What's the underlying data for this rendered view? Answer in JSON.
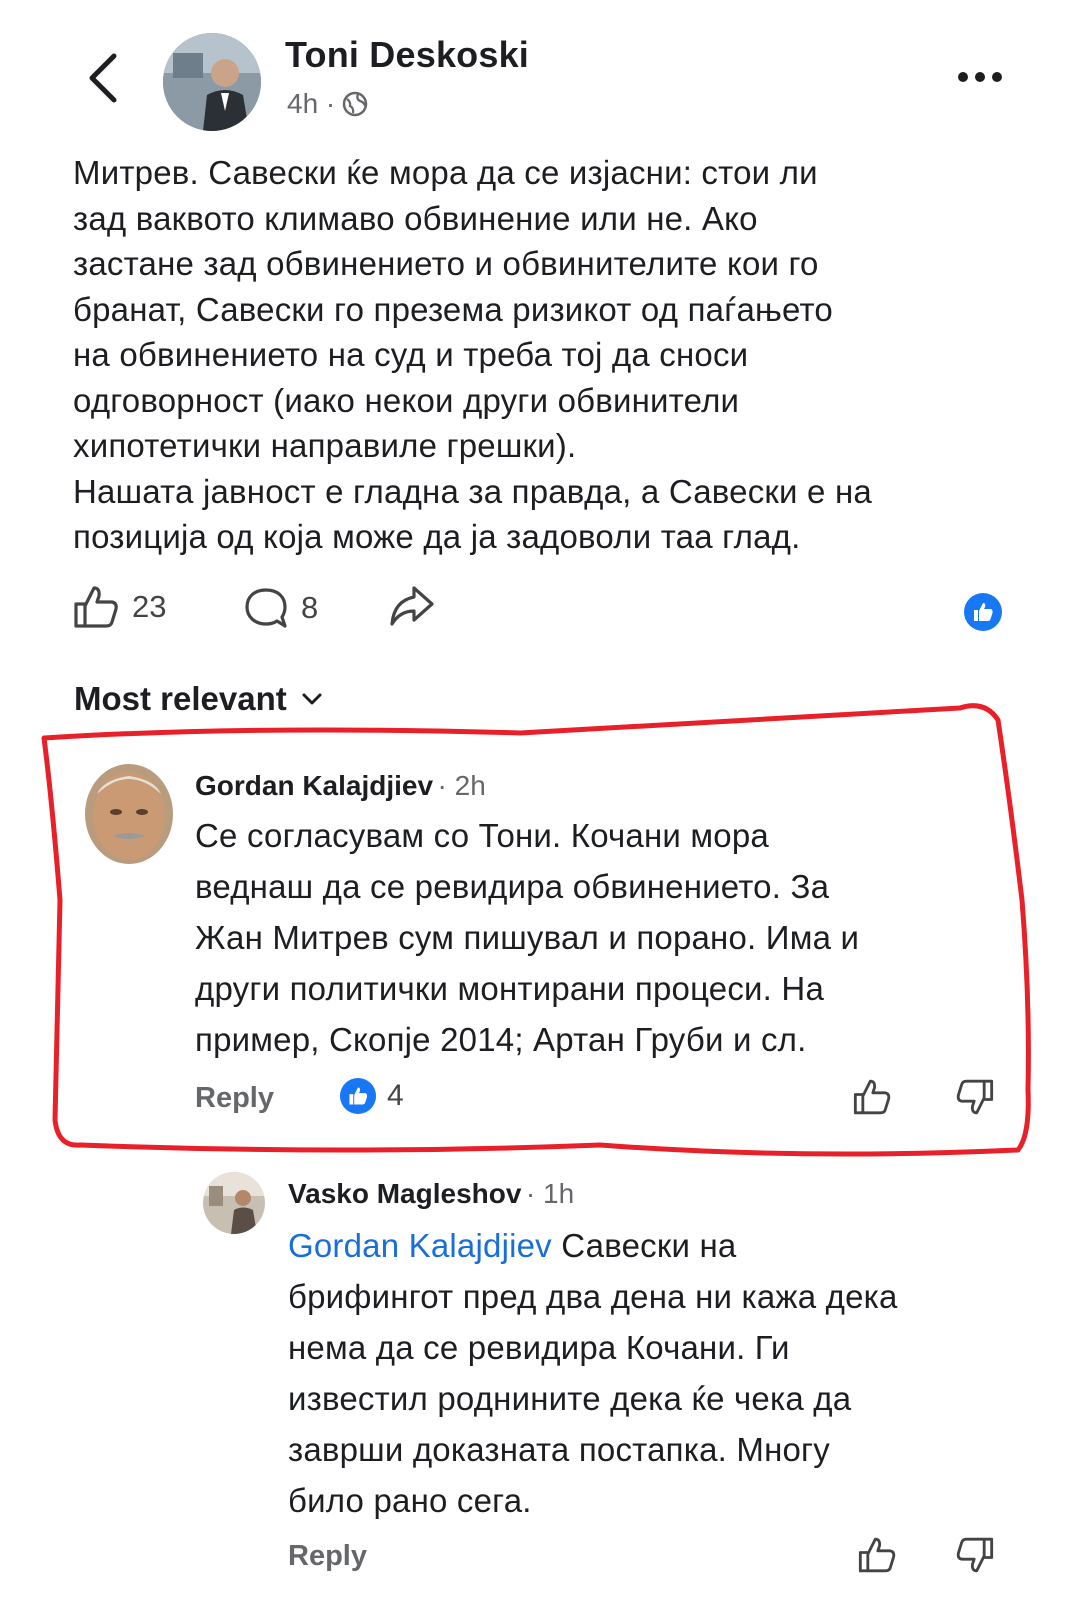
{
  "post": {
    "author": "Toni Deskoski",
    "time": "4h ·",
    "text_lines": [
      "Митрев. Савески ќе мора да се изјасни: стои ли",
      "зад ваквото климаво обвинение или не. Ако",
      "застане зад обвинението и обвинителите кои го",
      "бранат, Савески го презема ризикот од паѓањето",
      "на обвинението на суд и треба тој да сноси",
      "одговорност (иако некои други обвинители",
      "хипотетички направиле грешки).",
      "Нашата јавност е гладна за правда, а Савески е на",
      "позиција од која може да ја задоволи таа глад."
    ],
    "likes": "23",
    "comments": "8"
  },
  "sort_label": "Most relevant",
  "comments": [
    {
      "author": "Gordan Kalajdjiev",
      "time": "· 2h",
      "text_lines": [
        "Се согласувам со Тони. Кочани мора",
        "веднаш да се ревидира обвинението. За",
        "Жан Митрев сум пишувал и порано. Има и",
        "други политички монтирани процеси. На",
        "пример, Скопје 2014; Артан Груби и сл."
      ],
      "reply_label": "Reply",
      "reactions": "4"
    },
    {
      "author": "Vasko Magleshov",
      "time": "· 1h",
      "mention": "Gordan Kalajdjiev",
      "first_line_rest": " Савески на",
      "text_lines": [
        "брифингот пред два дена ни кажа дека",
        "нема да се ревидира Кочани. Ги",
        "известил роднините дека ќе чека да",
        "заврши доказната постапка. Многу",
        "било рано сега."
      ],
      "reply_label": "Reply"
    }
  ],
  "colors": {
    "accent": "#1877f2",
    "mention": "#1a6ed8",
    "highlight": "#e8202a",
    "muted": "#65676b"
  },
  "icons": [
    "back-icon",
    "globe-icon",
    "more-icon",
    "like-icon",
    "comment-icon",
    "share-icon",
    "thumbs-up-badge-icon",
    "chevron-down-icon",
    "dislike-icon"
  ]
}
